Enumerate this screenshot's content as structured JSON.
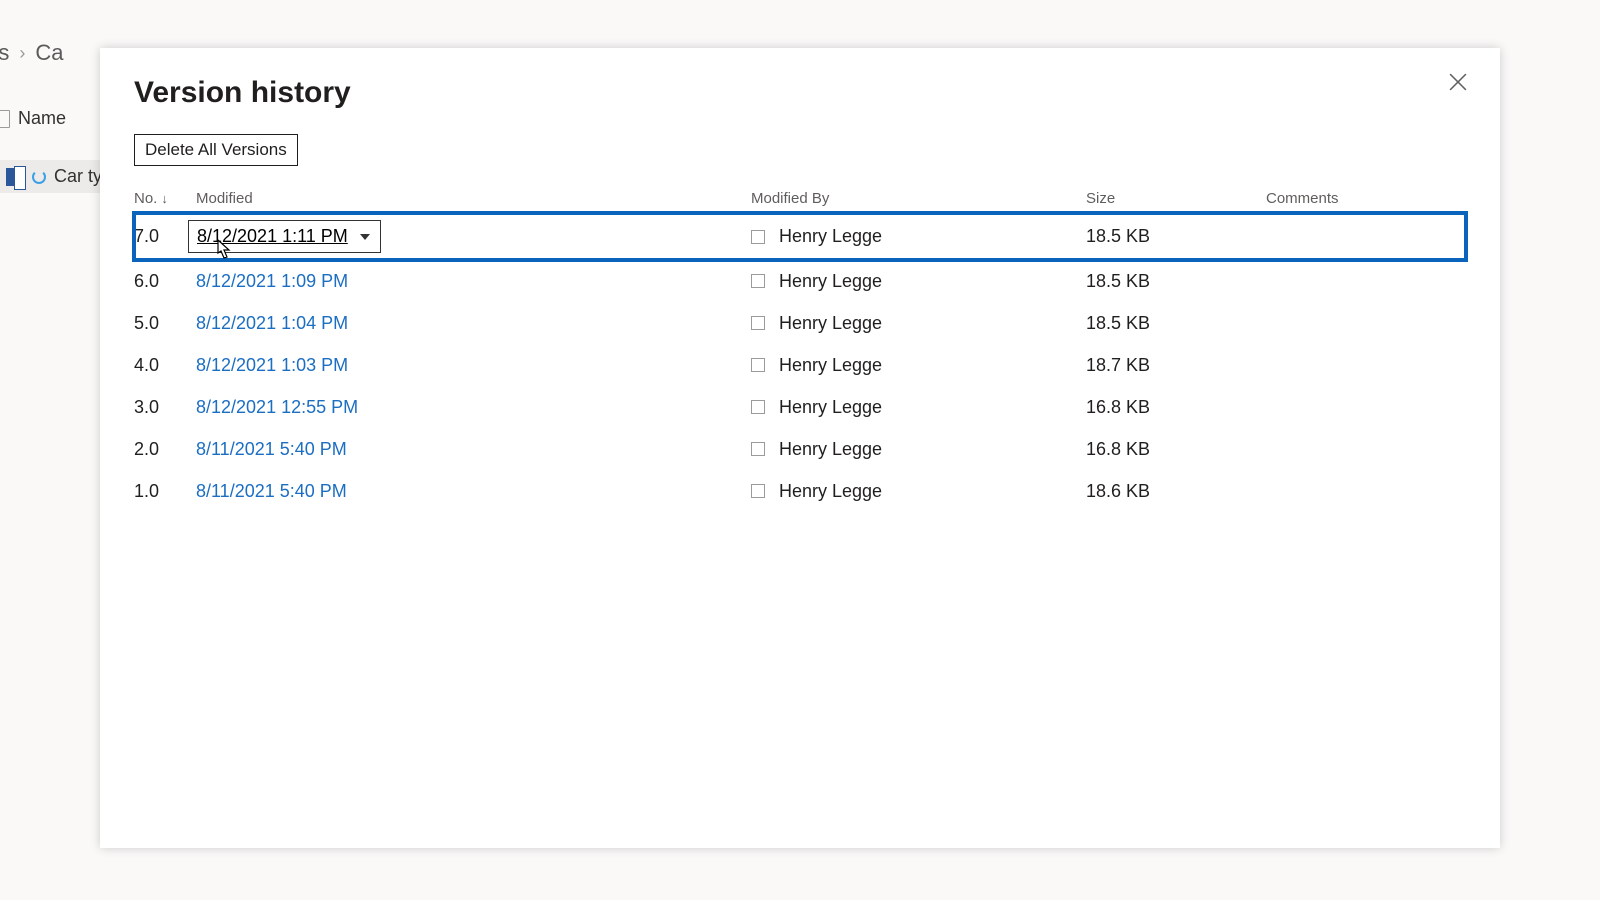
{
  "background": {
    "breadcrumb_part1": "nts",
    "breadcrumb_part2": "Ca",
    "list_header": "Name",
    "list_row": "Car typ"
  },
  "modal": {
    "title": "Version history",
    "delete_all_label": "Delete All Versions",
    "columns": {
      "no": "No.",
      "modified": "Modified",
      "modified_by": "Modified By",
      "size": "Size",
      "comments": "Comments"
    },
    "rows": [
      {
        "no": "7.0",
        "modified": "8/12/2021 1:11 PM",
        "modified_by": "Henry Legge",
        "size": "18.5 KB",
        "selected": true
      },
      {
        "no": "6.0",
        "modified": "8/12/2021 1:09 PM",
        "modified_by": "Henry Legge",
        "size": "18.5 KB",
        "selected": false
      },
      {
        "no": "5.0",
        "modified": "8/12/2021 1:04 PM",
        "modified_by": "Henry Legge",
        "size": "18.5 KB",
        "selected": false
      },
      {
        "no": "4.0",
        "modified": "8/12/2021 1:03 PM",
        "modified_by": "Henry Legge",
        "size": "18.7 KB",
        "selected": false
      },
      {
        "no": "3.0",
        "modified": "8/12/2021 12:55 PM",
        "modified_by": "Henry Legge",
        "size": "16.8 KB",
        "selected": false
      },
      {
        "no": "2.0",
        "modified": "8/11/2021 5:40 PM",
        "modified_by": "Henry Legge",
        "size": "16.8 KB",
        "selected": false
      },
      {
        "no": "1.0",
        "modified": "8/11/2021 5:40 PM",
        "modified_by": "Henry Legge",
        "size": "18.6 KB",
        "selected": false
      }
    ]
  }
}
